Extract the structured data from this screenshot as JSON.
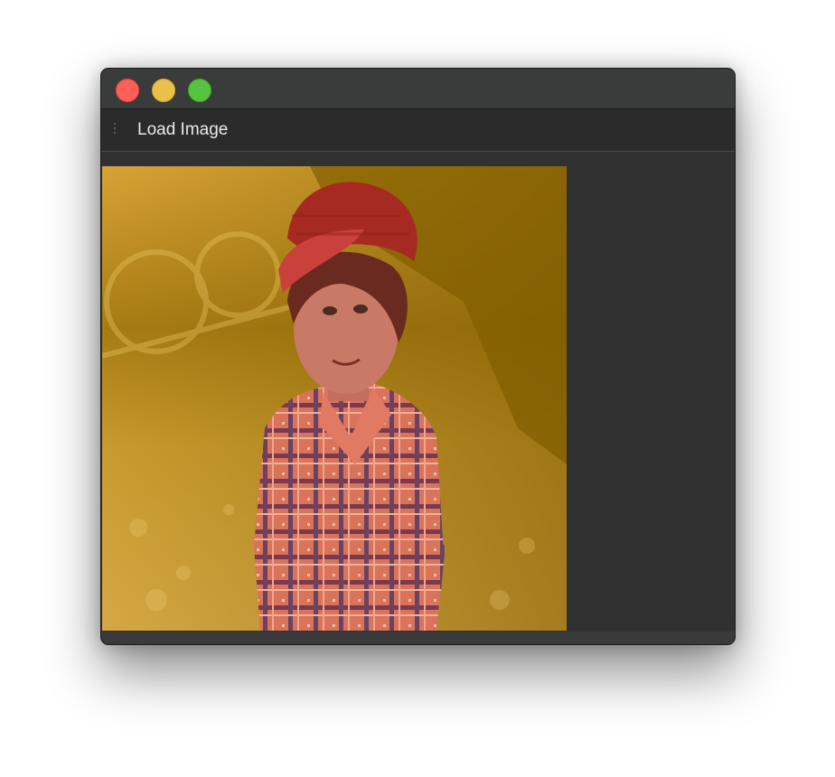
{
  "window": {
    "controls": [
      "close",
      "minimize",
      "zoom"
    ]
  },
  "toolbar": {
    "load_image_label": "Load Image"
  },
  "canvas": {
    "overlay_color": "#c8961e",
    "subject_overlay_color": "#b3322a"
  }
}
